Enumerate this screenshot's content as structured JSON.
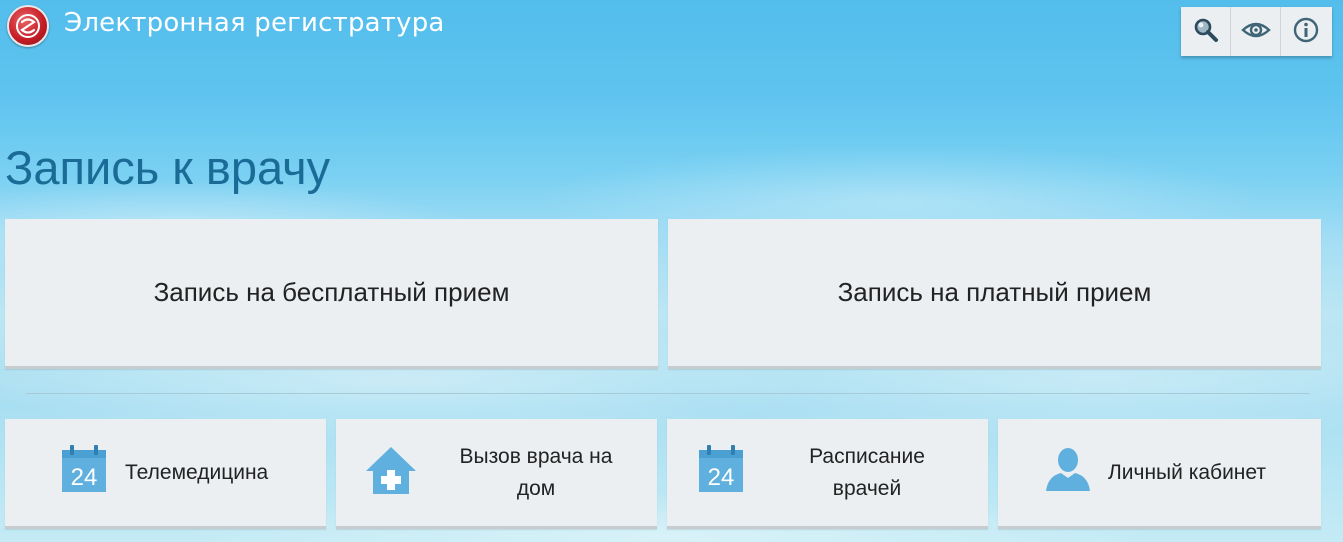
{
  "header": {
    "app_title": "Электронная регистратура",
    "logo_icon": "clinic-logo-icon",
    "tools": [
      {
        "icon": "magnifier-icon"
      },
      {
        "icon": "eye-icon"
      },
      {
        "icon": "info-icon"
      }
    ]
  },
  "main": {
    "page_title": "Запись к врачу",
    "primary_actions": [
      {
        "label": "Запись на бесплатный прием"
      },
      {
        "label": "Запись на платный прием"
      }
    ],
    "secondary_actions": [
      {
        "label": "Телемедицина",
        "icon": "calendar-icon",
        "icon_text": "24"
      },
      {
        "label_line1": "Вызов врача на",
        "label_line2": "дом",
        "icon": "house-plus-icon"
      },
      {
        "label_line1": "Расписание",
        "label_line2": "врачей",
        "icon": "calendar-icon",
        "icon_text": "24"
      },
      {
        "label": "Личный кабинет",
        "icon": "user-icon"
      }
    ]
  },
  "colors": {
    "title_blue": "#1b6b97",
    "card_bg": "#ebeff2",
    "icon_blue": "#5fb0df",
    "logo_red": "#c81e28"
  }
}
